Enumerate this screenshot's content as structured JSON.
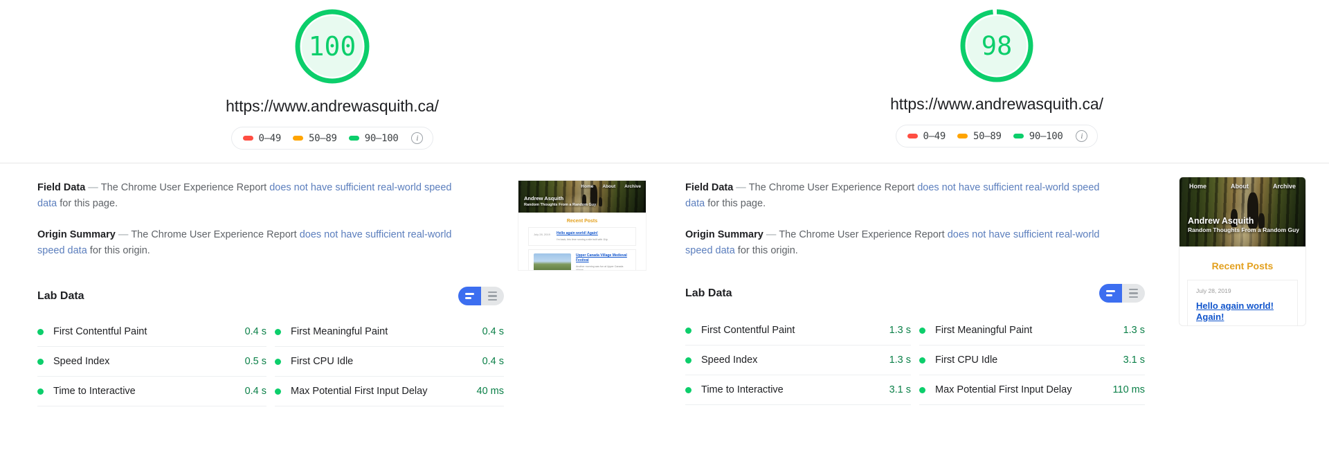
{
  "legend": {
    "ranges": [
      {
        "label": "0–49",
        "color": "#ff4e42",
        "name": "red"
      },
      {
        "label": "50–89",
        "color": "#ffa400",
        "name": "orange"
      },
      {
        "label": "90–100",
        "color": "#0cce6b",
        "name": "green"
      }
    ],
    "info_glyph": "i"
  },
  "reports": [
    {
      "id": "desktop",
      "score": "100",
      "score_value": 100,
      "score_color": "#0cce6b",
      "url": "https://www.andrewasquith.ca/",
      "field_data": {
        "title": "Field Data",
        "dash": "—",
        "text_before": "The Chrome User Experience Report ",
        "link_text": "does not have sufficient real-world speed data",
        "text_after": " for this page."
      },
      "origin_summary": {
        "title": "Origin Summary",
        "dash": "—",
        "text_before": "The Chrome User Experience Report ",
        "link_text": "does not have sufficient real-world speed data",
        "text_after": " for this origin."
      },
      "lab_data": {
        "title": "Lab Data",
        "view_toggle": {
          "active": "bars-view",
          "inactive": "list-view"
        },
        "metrics_left": [
          {
            "name": "First Contentful Paint",
            "value": "0.4 s",
            "status": "pass"
          },
          {
            "name": "Speed Index",
            "value": "0.5 s",
            "status": "pass"
          },
          {
            "name": "Time to Interactive",
            "value": "0.4 s",
            "status": "pass"
          }
        ],
        "metrics_right": [
          {
            "name": "First Meaningful Paint",
            "value": "0.4 s",
            "status": "pass"
          },
          {
            "name": "First CPU Idle",
            "value": "0.4 s",
            "status": "pass"
          },
          {
            "name": "Max Potential First Input Delay",
            "value": "40 ms",
            "status": "pass"
          }
        ]
      }
    },
    {
      "id": "mobile",
      "score": "98",
      "score_value": 98,
      "score_color": "#0cce6b",
      "url": "https://www.andrewasquith.ca/",
      "field_data": {
        "title": "Field Data",
        "dash": "—",
        "text_before": "The Chrome User Experience Report ",
        "link_text": "does not have sufficient real-world speed data",
        "text_after": " for this page."
      },
      "origin_summary": {
        "title": "Origin Summary",
        "dash": "—",
        "text_before": "The Chrome User Experience Report ",
        "link_text": "does not have sufficient real-world speed data",
        "text_after": " for this origin."
      },
      "lab_data": {
        "title": "Lab Data",
        "view_toggle": {
          "active": "bars-view",
          "inactive": "list-view"
        },
        "metrics_left": [
          {
            "name": "First Contentful Paint",
            "value": "1.3 s",
            "status": "pass"
          },
          {
            "name": "Speed Index",
            "value": "1.3 s",
            "status": "pass"
          },
          {
            "name": "Time to Interactive",
            "value": "3.1 s",
            "status": "pass"
          }
        ],
        "metrics_right": [
          {
            "name": "First Meaningful Paint",
            "value": "1.3 s",
            "status": "pass"
          },
          {
            "name": "First CPU Idle",
            "value": "3.1 s",
            "status": "pass"
          },
          {
            "name": "Max Potential First Input Delay",
            "value": "110 ms",
            "status": "pass"
          }
        ]
      }
    }
  ],
  "thumbnail": {
    "nav": [
      "Home",
      "About",
      "Archive"
    ],
    "site_title": "Andrew Asquith",
    "site_tagline": "Random Thoughts From a Random Guy",
    "recent_posts_heading": "Recent Posts",
    "posts": [
      {
        "date": "July 28, 2019",
        "title": "Hello again world! Again!",
        "excerpt": "I'm back, this time running a site built with 11ty."
      },
      {
        "date": "",
        "title": "Upper Canada Village Medieval Festival",
        "excerpt": "Another morning was fun at Upper Canada Village."
      }
    ]
  }
}
